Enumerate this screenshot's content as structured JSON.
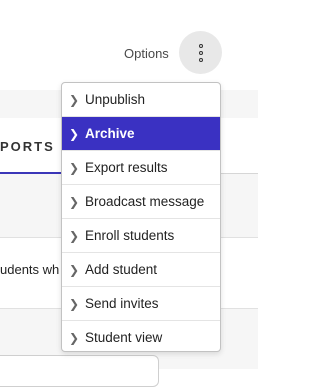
{
  "header": {
    "options_label": "Options"
  },
  "tabs": {
    "reports_fragment": "PORTS"
  },
  "content": {
    "info_fragment": "udents wh"
  },
  "options_menu": {
    "items": [
      {
        "label": "Unpublish",
        "active": false
      },
      {
        "label": "Archive",
        "active": true
      },
      {
        "label": "Export results",
        "active": false
      },
      {
        "label": "Broadcast message",
        "active": false
      },
      {
        "label": "Enroll students",
        "active": false
      },
      {
        "label": "Add student",
        "active": false
      },
      {
        "label": "Send invites",
        "active": false
      },
      {
        "label": "Student view",
        "active": false
      }
    ],
    "highlight_color": "#3a31c2",
    "item_icon": "chevron-right-icon"
  },
  "colors": {
    "accent": "#3a31c2",
    "tab_underline": "#3b36b8",
    "options_button_bg": "#e8e8e8"
  }
}
